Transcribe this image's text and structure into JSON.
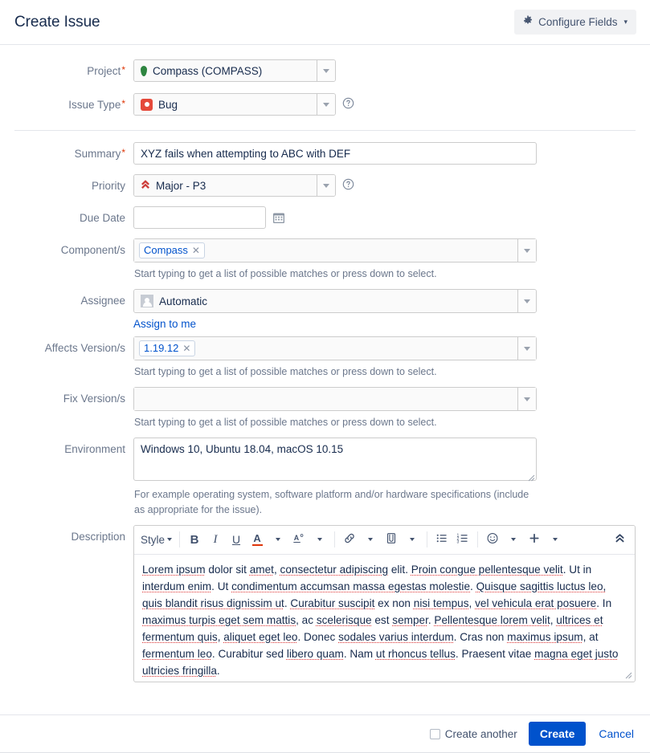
{
  "header": {
    "title": "Create Issue",
    "configure_fields_label": "Configure Fields",
    "gear_icon": "gear-icon",
    "caret": "▾"
  },
  "fields": {
    "project": {
      "label": "Project",
      "required": true,
      "value": "Compass  (COMPASS)",
      "icon": "compass-leaf-icon",
      "icon_color": "#2e8540"
    },
    "issue_type": {
      "label": "Issue Type",
      "required": true,
      "value": "Bug",
      "icon": "bug-icon",
      "icon_color": "#e5493a",
      "has_help": true
    },
    "summary": {
      "label": "Summary",
      "required": true,
      "value": "XYZ fails when attempting to ABC with DEF",
      "placeholder": ""
    },
    "priority": {
      "label": "Priority",
      "required": false,
      "value": "Major - P3",
      "icon": "priority-major-icon",
      "icon_color": "#cd3c39",
      "has_help": true
    },
    "due_date": {
      "label": "Due Date",
      "value": "",
      "placeholder": "",
      "icon": "calendar-icon"
    },
    "components": {
      "label": "Component/s",
      "chips": [
        "Compass"
      ],
      "help": "Start typing to get a list of possible matches or press down to select."
    },
    "assignee": {
      "label": "Assignee",
      "value": "Automatic",
      "icon": "user-avatar-icon",
      "assign_to_me": "Assign to me"
    },
    "affects_versions": {
      "label": "Affects Version/s",
      "chips": [
        "1.19.12"
      ],
      "help": "Start typing to get a list of possible matches or press down to select."
    },
    "fix_versions": {
      "label": "Fix Version/s",
      "chips": [],
      "help": "Start typing to get a list of possible matches or press down to select."
    },
    "environment": {
      "label": "Environment",
      "value": "Windows 10, Ubuntu 18.04, macOS 10.15",
      "help": "For example operating system, software platform and/or hardware specifications (include as appropriate for the issue)."
    },
    "description": {
      "label": "Description",
      "toolbar": {
        "style_label": "Style",
        "bold_label": "B",
        "italic_label": "I",
        "underline_label": "U",
        "text_color_label": "A",
        "more_formatting_label": "A",
        "link_icon": "link-icon",
        "mention_icon": "attachment-icon",
        "bullet_list_icon": "bullet-list-icon",
        "numbered_list_icon": "numbered-list-icon",
        "emoji_icon": "emoji-icon",
        "insert_icon": "plus-icon",
        "collapse_icon": "double-chevron-up-icon"
      },
      "content_runs": [
        {
          "t": "Lorem ipsum",
          "s": true
        },
        {
          "t": " dolor sit ",
          "s": false
        },
        {
          "t": "amet",
          "s": true
        },
        {
          "t": ", ",
          "s": false
        },
        {
          "t": "consectetur adipiscing",
          "s": true
        },
        {
          "t": " elit. ",
          "s": false
        },
        {
          "t": "Proin congue pellentesque velit",
          "s": true
        },
        {
          "t": ". Ut in ",
          "s": false
        },
        {
          "t": "interdum enim",
          "s": true
        },
        {
          "t": ". Ut ",
          "s": false
        },
        {
          "t": "condimentum accumsan massa egestas molestie",
          "s": true
        },
        {
          "t": ". ",
          "s": false
        },
        {
          "t": "Quisque sagittis luctus leo, quis blandit risus dignissim ut",
          "s": true
        },
        {
          "t": ". ",
          "s": false
        },
        {
          "t": "Curabitur suscipit",
          "s": true
        },
        {
          "t": " ex non ",
          "s": false
        },
        {
          "t": "nisi tempus",
          "s": true
        },
        {
          "t": ", ",
          "s": false
        },
        {
          "t": "vel vehicula erat posuere",
          "s": true
        },
        {
          "t": ". In ",
          "s": false
        },
        {
          "t": "maximus turpis eget sem mattis",
          "s": true
        },
        {
          "t": ", ac ",
          "s": false
        },
        {
          "t": "scelerisque",
          "s": true
        },
        {
          "t": " est ",
          "s": false
        },
        {
          "t": "semper",
          "s": true
        },
        {
          "t": ". ",
          "s": false
        },
        {
          "t": "Pellentesque lorem velit",
          "s": true
        },
        {
          "t": ", ",
          "s": false
        },
        {
          "t": "ultrices et fermentum quis",
          "s": true
        },
        {
          "t": ", ",
          "s": false
        },
        {
          "t": "aliquet eget leo",
          "s": true
        },
        {
          "t": ". Donec ",
          "s": false
        },
        {
          "t": "sodales varius interdum",
          "s": true
        },
        {
          "t": ". Cras non ",
          "s": false
        },
        {
          "t": "maximus ipsum",
          "s": true
        },
        {
          "t": ", at ",
          "s": false
        },
        {
          "t": "fermentum leo",
          "s": true
        },
        {
          "t": ". Curabitur sed ",
          "s": false
        },
        {
          "t": "libero quam",
          "s": true
        },
        {
          "t": ". Nam ",
          "s": false
        },
        {
          "t": "ut rhoncus tellus",
          "s": true
        },
        {
          "t": ". Praesent vitae ",
          "s": false
        },
        {
          "t": "magna eget justo ultricies fringilla",
          "s": true
        },
        {
          "t": ".",
          "s": false
        }
      ],
      "content_plain": "Lorem ipsum dolor sit amet, consectetur adipiscing elit. Proin congue pellentesque velit. Ut in interdum enim. Ut condimentum accumsan massa egestas molestie. Quisque sagittis luctus leo, quis blandit risus dignissim ut. Curabitur suscipit ex non nisi tempus, vel vehicula erat posuere. In maximus turpis eget sem mattis, ac scelerisque est semper. Pellentesque lorem velit, ultrices et fermentum quis, aliquet eget leo. Donec sodales varius interdum. Cras non maximus ipsum, at fermentum leo. Curabitur sed libero quam. Nam ut rhoncus tellus. Praesent vitae magna eget justo ultricies fringilla."
    }
  },
  "footer": {
    "create_another_label": "Create another",
    "create_another_checked": false,
    "create_label": "Create",
    "cancel_label": "Cancel",
    "primary_color": "#0052cc"
  }
}
